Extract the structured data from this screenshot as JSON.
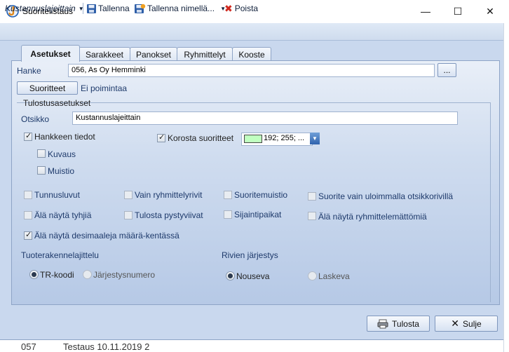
{
  "window": {
    "title": "Suoritelistaus",
    "minimize": "—",
    "maximize": "☐",
    "close": "✕"
  },
  "toolbar": {
    "report_select": "Kustannuslajeittain",
    "save": "Tallenna",
    "save_as": "Tallenna nimellä...",
    "delete": "Poista"
  },
  "tabs": [
    "Asetukset",
    "Sarakkeet",
    "Panokset",
    "Ryhmittelyt",
    "Kooste"
  ],
  "settings": {
    "hanke_label": "Hanke",
    "hanke_value": "056, As Oy Hemminki",
    "browse": "...",
    "suoritteet_button": "Suoritteet",
    "suoritteet_status": "Ei poimintaa",
    "print_group_title": "Tulostusasetukset",
    "otsikko_label": "Otsikko",
    "otsikko_value": "Kustannuslajeittain",
    "hankkeen_tiedot": "Hankkeen tiedot",
    "kuvaus": "Kuvaus",
    "muistio": "Muistio",
    "korosta": "Korosta suoritteet",
    "color_value": "192; 255; ...",
    "highlight_color": "#c0ffc0",
    "tunnusluvut": "Tunnusluvut",
    "vain_ryhmittelyrivit": "Vain ryhmittelyrivit",
    "suoritemuistio": "Suoritemuistio",
    "suorite_vain": "Suorite vain uloimmalla otsikkorivillä",
    "ala_tyhjia": "Älä näytä tyhjiä",
    "pystyviivat": "Tulosta pystyviivat",
    "sijaintipaikat": "Sijaintipaikat",
    "ala_ryhmittelemattomia": "Älä näytä ryhmittelemättömiä",
    "desimaaleja": "Älä näytä desimaaleja määrä-kentässä",
    "tuoterakenne_label": "Tuoterakennelajittelu",
    "tr_koodi": "TR-koodi",
    "jarjestysnumero": "Järjestysnumero",
    "rivien_label": "Rivien järjestys",
    "nouseva": "Nouseva",
    "laskeva": "Laskeva"
  },
  "footer": {
    "print": "Tulosta",
    "close": "Sulje"
  },
  "behind_window": {
    "text1": "057",
    "text2": "Testaus 10.11.2019 2"
  }
}
